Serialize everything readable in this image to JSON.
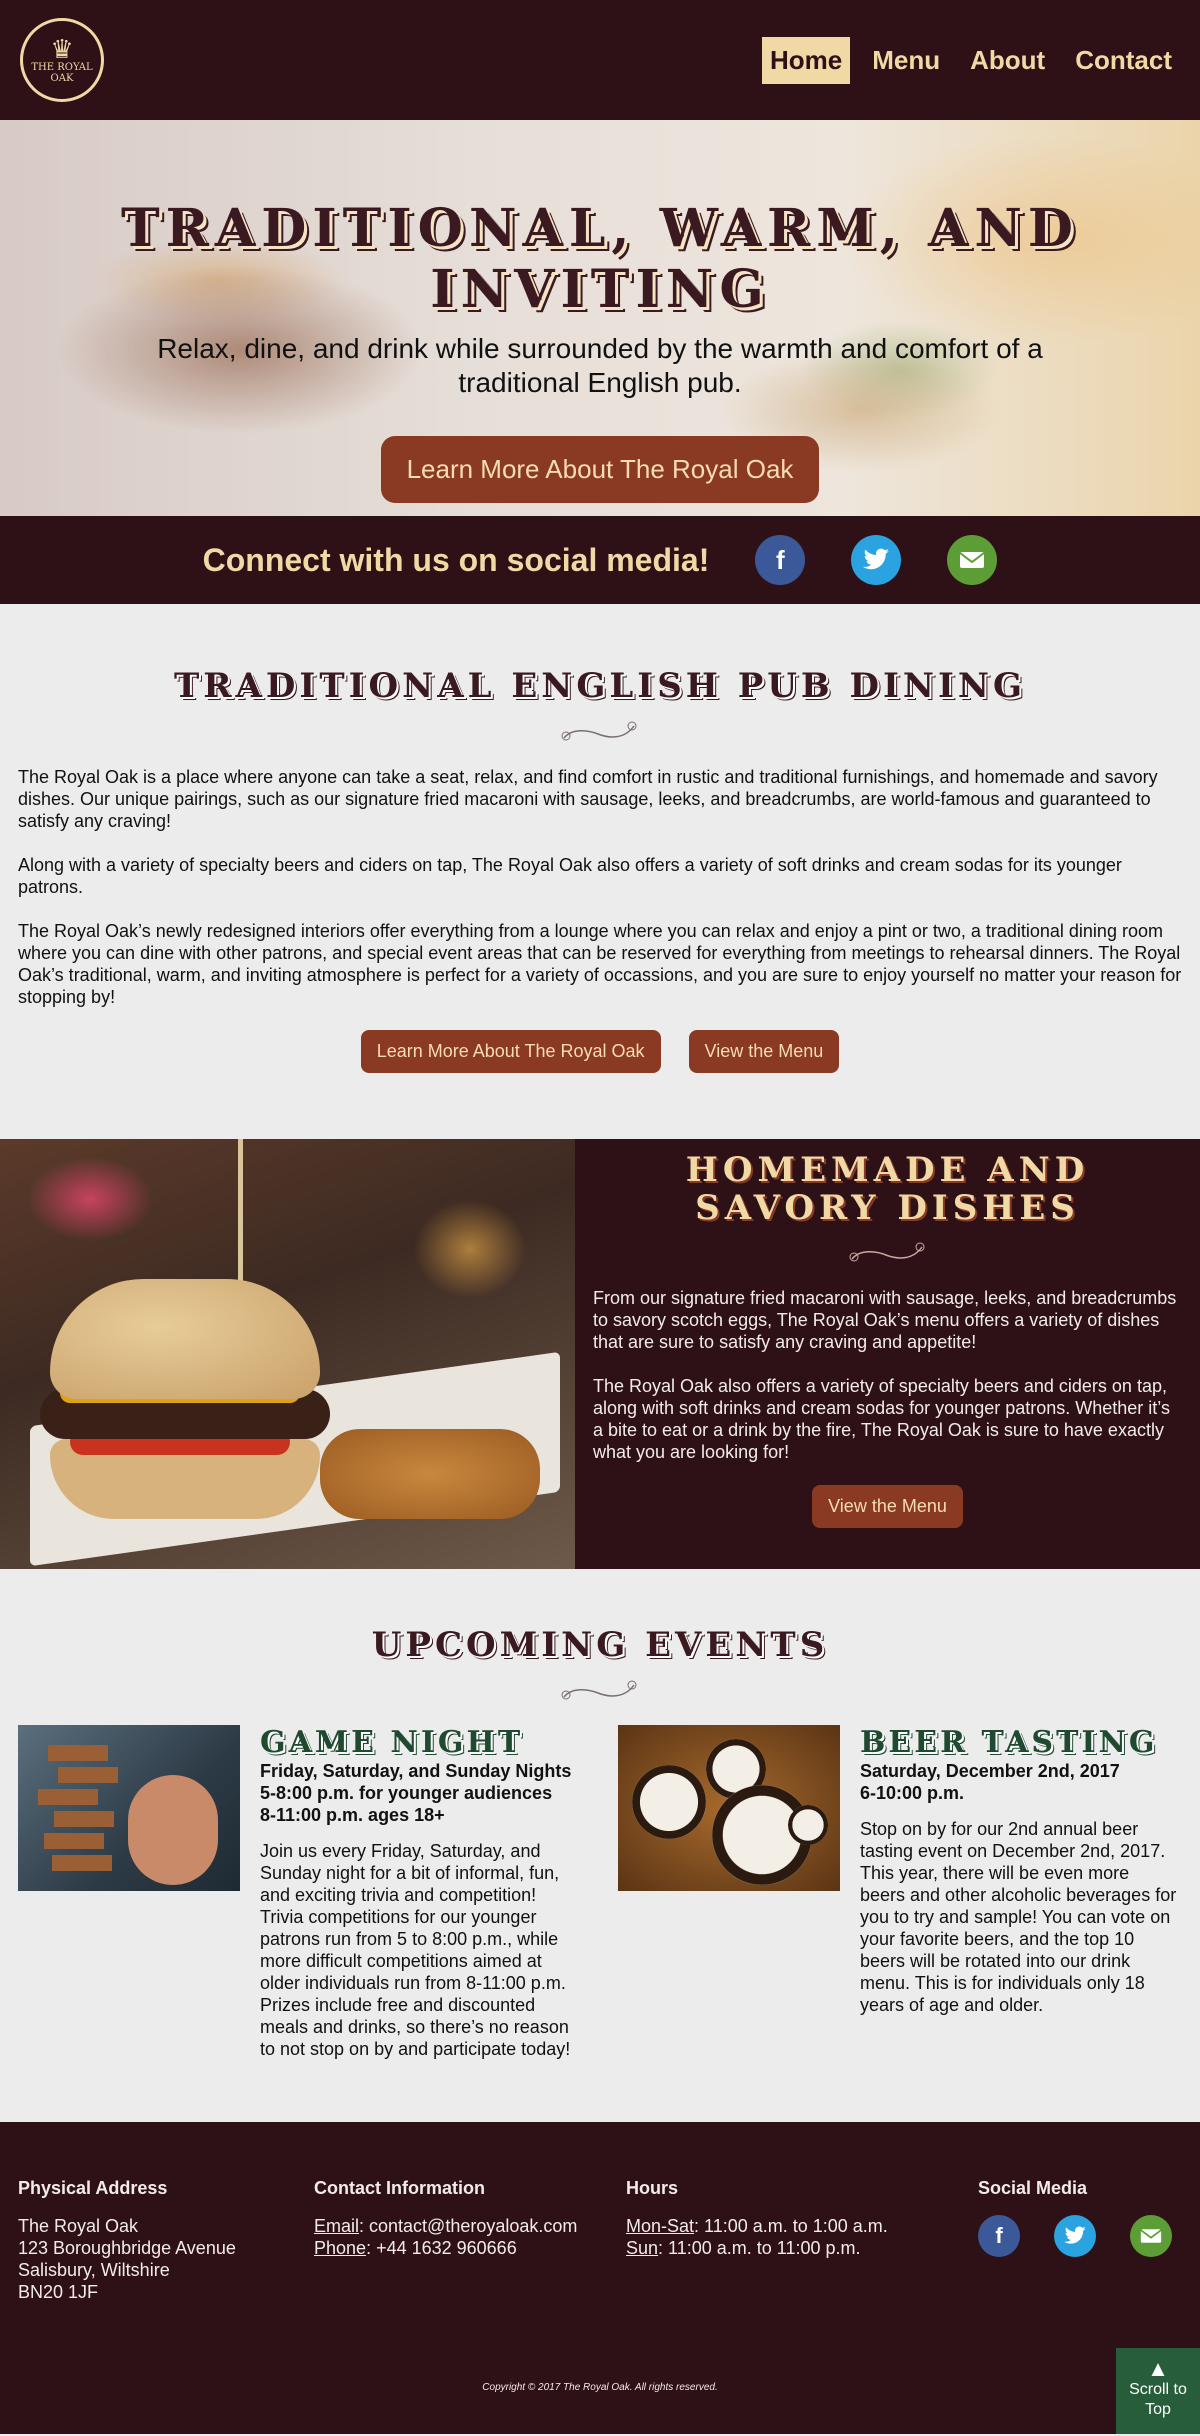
{
  "nav": {
    "logo_line1": "THE ROYAL",
    "logo_line2": "OAK",
    "items": [
      {
        "label": "Home",
        "active": true
      },
      {
        "label": "Menu",
        "active": false
      },
      {
        "label": "About",
        "active": false
      },
      {
        "label": "Contact",
        "active": false
      }
    ]
  },
  "hero": {
    "title": "Traditional, Warm, and Inviting",
    "subtitle": "Relax, dine, and drink while surrounded by the warmth and comfort of a traditional English pub.",
    "button": "Learn More About The Royal Oak"
  },
  "social": {
    "heading": "Connect with us on social media!",
    "icons": [
      "facebook-icon",
      "twitter-icon",
      "email-icon"
    ]
  },
  "intro": {
    "title": "Traditional English Pub Dining",
    "paragraphs": [
      "The Royal Oak is a place where anyone can take a seat, relax, and find comfort in rustic and traditional furnishings, and homemade and savory dishes. Our unique pairings, such as our signature fried macaroni with sausage, leeks, and breadcrumbs, are world-famous and guaranteed to satisfy any craving!",
      "Along with a variety of specialty beers and ciders on tap, The Royal Oak also offers a variety of soft drinks and cream sodas for its younger patrons.",
      "The Royal Oak’s newly redesigned interiors offer everything from a lounge where you can relax and enjoy a pint or two, a traditional dining room where you can dine with other patrons, and special event areas that can be reserved for everything from meetings to rehearsal dinners. The Royal Oak’s traditional, warm, and inviting atmosphere is perfect for a variety of occassions, and you are sure to enjoy yourself no matter your reason for stopping by!"
    ],
    "button_learn": "Learn More About The Royal Oak",
    "button_menu": "View the Menu"
  },
  "feature": {
    "title_line1": "Homemade and",
    "title_line2": "Savory Dishes",
    "paragraphs": [
      "From our signature fried macaroni with sausage, leeks, and breadcrumbs to savory scotch eggs, The Royal Oak’s menu offers a variety of dishes that are sure to satisfy any craving and appetite!",
      "The Royal Oak also offers a variety of specialty beers and ciders on tap, along with soft drinks and cream sodas for younger patrons. Whether it’s a bite to eat or a drink by the fire, The Royal Oak is sure to have exactly what you are looking for!"
    ],
    "button": "View the Menu"
  },
  "events": {
    "title": "Upcoming Events",
    "items": [
      {
        "title": "Game Night",
        "meta": [
          "Friday, Saturday, and Sunday Nights",
          "5-8:00 p.m. for younger audiences",
          "8-11:00 p.m. ages 18+"
        ],
        "description": "Join us every Friday, Saturday, and Sunday night for a bit of informal, fun, and exciting trivia and competition! Trivia competitions for our younger patrons run from 5 to 8:00 p.m., while more difficult competitions aimed at older individuals run from 8-11:00 p.m. Prizes include free and discounted meals and drinks, so there’s no reason to not stop on by and participate today!"
      },
      {
        "title": "Beer Tasting",
        "meta": [
          "Saturday, December 2nd, 2017",
          "6-10:00 p.m."
        ],
        "description": "Stop on by for our 2nd annual beer tasting event on December 2nd, 2017. This year, there will be even more beers and other alcoholic beverages for you to try and sample! You can vote on your favorite beers, and the top 10 beers will be rotated into our drink menu. This is for individuals only 18 years of age and older."
      }
    ]
  },
  "footer": {
    "address": {
      "heading": "Physical Address",
      "lines": [
        "The Royal Oak",
        "123 Boroughbridge Avenue",
        "Salisbury, Wiltshire",
        "BN20 1JF"
      ]
    },
    "contact": {
      "heading": "Contact Information",
      "email_label": "Email",
      "email_value": ": contact@theroyaloak.com",
      "phone_label": "Phone",
      "phone_value": ": +44 1632 960666"
    },
    "hours": {
      "heading": "Hours",
      "weekday_label": "Mon-Sat",
      "weekday_value": ": 11:00 a.m. to 1:00 a.m.",
      "sunday_label": "Sun",
      "sunday_value": ": 11:00 a.m. to 11:00 p.m."
    },
    "social": {
      "heading": "Social Media",
      "icons": [
        "facebook-icon",
        "twitter-icon",
        "email-icon"
      ]
    },
    "copyright": "Copyright © 2017 The Royal Oak. All rights reserved.",
    "scroll_label": "Scroll to Top"
  },
  "colors": {
    "maroon": "#2e1117",
    "cream": "#f1d9a6",
    "button": "#8a3a22",
    "green": "#275d3a",
    "facebook": "#3b5998",
    "twitter": "#2aa3e0",
    "email": "#5d9d35"
  }
}
